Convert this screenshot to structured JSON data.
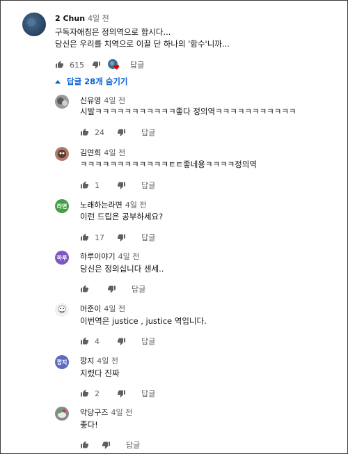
{
  "top_comment": {
    "author": "2 Chun",
    "time": "4일 전",
    "lines": [
      "구독자애칭은 정의역으로 합시다...",
      "당신은 우리를 치역으로 이끌 단 하나의 '함수'니까..."
    ],
    "likes": "615",
    "reply_label": "답글"
  },
  "replies_toggle": {
    "label": "답글 28개 숨기기"
  },
  "replies": [
    {
      "author": "신유영",
      "time": "4일 전",
      "text": "시발ㅋㅋㅋㅋㅋㅋㅋㅋㅋㅋㅋ좋다 정의역ㅋㅋㅋㅋㅋㅋㅋㅋㅋㅋㅋ",
      "likes": "24",
      "reply_label": "답글",
      "avatar_color": "#7a7a7a"
    },
    {
      "author": "김연희",
      "time": "4일 전",
      "text": "ㅋㅋㅋㅋㅋㅋㅋㅋㅋㅋㅋㅋㅌㅌ좋네용ㅋㅋㅋㅋ정의역",
      "likes": "1",
      "reply_label": "답글",
      "avatar_color": "#8a5a4a"
    },
    {
      "author": "노래하는라면",
      "time": "4일 전",
      "text": "이런 드립은 공부하세요?",
      "likes": "17",
      "reply_label": "답글",
      "avatar_color": "#43a047",
      "avatar_initial": "라면"
    },
    {
      "author": "하루이야기",
      "time": "4일 전",
      "text": "당신은 정의십니다 센세..",
      "likes": "",
      "reply_label": "답글",
      "avatar_color": "#7e57c2",
      "avatar_initial": "하루"
    },
    {
      "author": "머준이",
      "time": "4일 전",
      "text": "이번역은 justice , justice 역입니다.",
      "likes": "4",
      "reply_label": "답글",
      "avatar_color": "#e8e8e8"
    },
    {
      "author": "깡지",
      "time": "4일 전",
      "text": "지렸다 진짜",
      "likes": "2",
      "reply_label": "답글",
      "avatar_color": "#5c6bc0",
      "avatar_initial": "깡지"
    },
    {
      "author": "악당구즈",
      "time": "4일 전",
      "text": "좋다!",
      "likes": "",
      "reply_label": "답글",
      "avatar_color": "#6d6d6d"
    }
  ]
}
